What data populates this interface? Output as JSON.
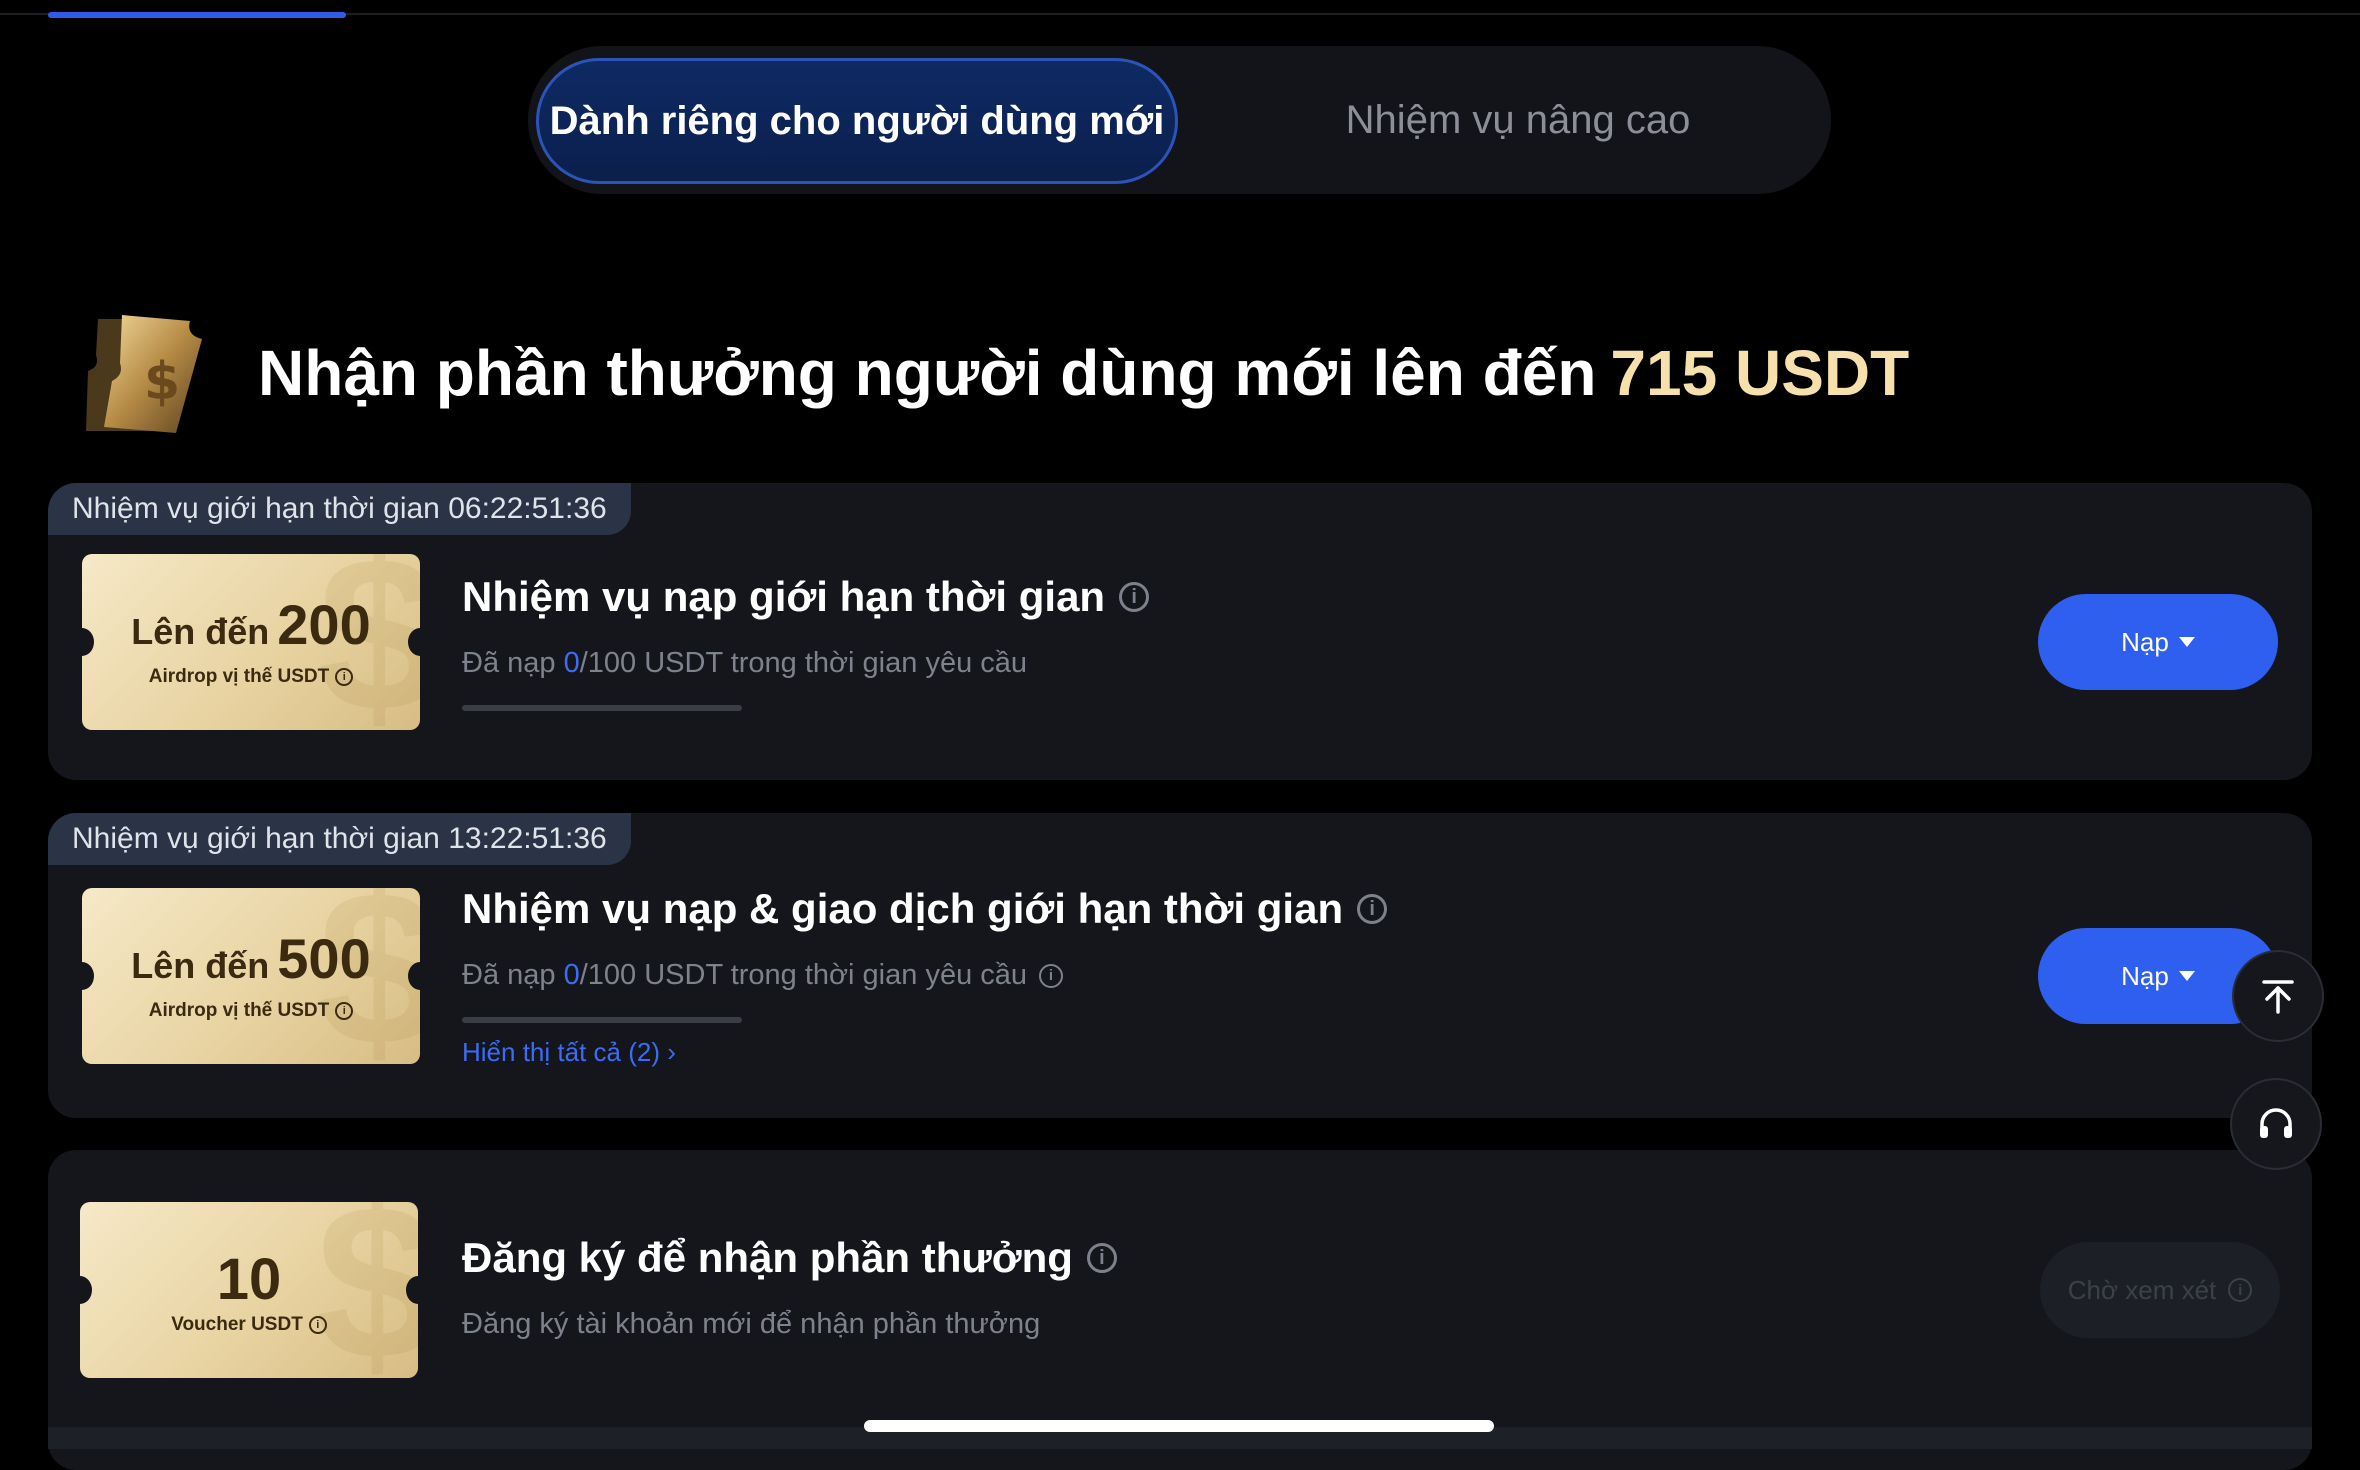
{
  "tabs": {
    "new_user": "Dành riêng cho người dùng mới",
    "advanced": "Nhiệm vụ nâng cao"
  },
  "hero": {
    "title": "Nhận phần thưởng người dùng mới lên đến",
    "amount": "715 USDT",
    "icon": "ticket-dollar-icon"
  },
  "tasks": [
    {
      "timer_label": "Nhiệm vụ giới hạn thời gian 06:22:51:36",
      "voucher_prefix": "Lên đến",
      "voucher_value": "200",
      "voucher_sub": "Airdrop vị thế USDT",
      "title": "Nhiệm vụ nạp giới hạn thời gian",
      "desc_prefix": "Đã nạp",
      "desc_current": "0",
      "desc_suffix": "/100 USDT trong thời gian yêu cầu",
      "progress": 0,
      "button": "Nạp"
    },
    {
      "timer_label": "Nhiệm vụ giới hạn thời gian 13:22:51:36",
      "voucher_prefix": "Lên đến",
      "voucher_value": "500",
      "voucher_sub": "Airdrop vị thế USDT",
      "title": "Nhiệm vụ nạp & giao dịch giới hạn thời gian",
      "desc_prefix": "Đã nạp",
      "desc_current": "0",
      "desc_suffix": "/100 USDT trong thời gian yêu cầu",
      "progress": 0,
      "show_all": "Hiển thị tất cả (2)",
      "button": "Nạp"
    },
    {
      "voucher_value": "10",
      "voucher_sub": "Voucher USDT",
      "title": "Đăng ký để nhận phần thưởng",
      "desc": "Đăng ký tài khoản mới để nhận phần thưởng",
      "button": "Chờ xem xét"
    }
  ],
  "colors": {
    "accent": "#2f5fef",
    "gold": "#f6e1ac",
    "card_bg": "#14161c"
  }
}
